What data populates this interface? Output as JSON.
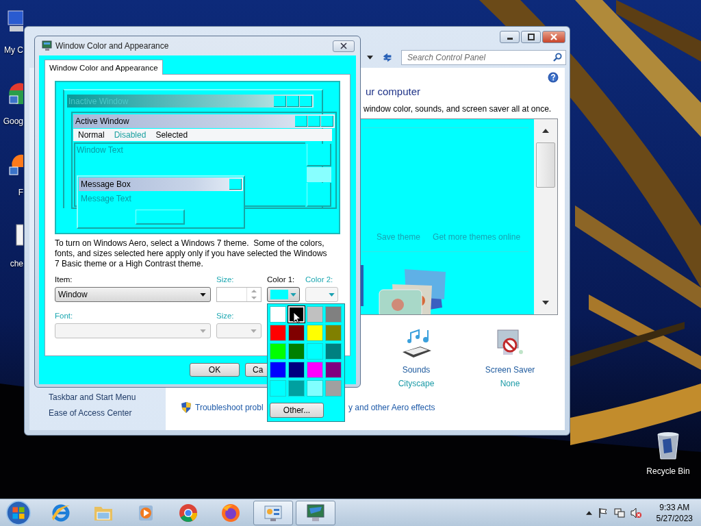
{
  "desktop_icons": [
    {
      "kind": "computer",
      "label": "My C"
    },
    {
      "kind": "chrome",
      "label": "Goog"
    },
    {
      "kind": "firefox",
      "label": "F"
    },
    {
      "kind": "document",
      "label": "che"
    }
  ],
  "recycle_bin": {
    "label": "Recycle Bin"
  },
  "control_panel": {
    "search": {
      "placeholder": "Search Control Panel"
    },
    "heading": "ur computer",
    "intro": "window color, sounds, and screen saver all at once.",
    "theme_links": [
      "Save theme",
      "Get more themes online"
    ],
    "settings": [
      {
        "kind": "sounds",
        "label": "Sounds",
        "value": "Cityscape"
      },
      {
        "kind": "screensaver",
        "label": "Screen Saver",
        "value": "None"
      }
    ],
    "sidebar_links": [
      "Taskbar and Start Menu",
      "Ease of Access Center"
    ],
    "tasks": [
      "Troubleshoot probl",
      "y and other Aero effects"
    ]
  },
  "dialog": {
    "title": "Window Color and Appearance",
    "tabs": [
      {
        "label": "Window Color and Appearance",
        "selected": true
      }
    ],
    "preview": {
      "inactive_title": "Inactive Window",
      "active_title": "Active Window",
      "menu": [
        {
          "kind": "normal",
          "label": "Normal"
        },
        {
          "kind": "disabled",
          "label": "Disabled"
        },
        {
          "kind": "selected",
          "label": "Selected"
        }
      ],
      "window_text": "Window Text",
      "message_title": "Message Box",
      "message_text": "Message Text"
    },
    "note": "To turn on Windows Aero, select a Windows 7 theme.  Some of the colors, fonts, and sizes selected here apply only if you have selected the Windows 7 Basic theme or a High Contrast theme.",
    "fields": [
      {
        "kind": "dropdown",
        "label": "Item:",
        "value": "Window",
        "disabled": false
      },
      {
        "kind": "spinner",
        "label": "Size:",
        "disabled": true
      },
      {
        "kind": "color",
        "label": "Color 1:",
        "color": "#00ffff",
        "disabled": false
      },
      {
        "kind": "color",
        "label": "Color 2:",
        "disabled": true
      },
      {
        "kind": "dropdown",
        "label": "Font:",
        "disabled": true
      },
      {
        "kind": "small_dropdown",
        "label": "Size:",
        "disabled": true
      }
    ],
    "buttons": [
      "OK",
      "Ca"
    ]
  },
  "color_menu": {
    "swatches": [
      {
        "color": "#ffffff",
        "selected": false
      },
      {
        "color": "#000000",
        "selected": true
      },
      {
        "color": "#c0c0c0",
        "selected": false
      },
      {
        "color": "#808080",
        "selected": false
      },
      {
        "color": "#ff0000",
        "selected": false
      },
      {
        "color": "#800000",
        "selected": false
      },
      {
        "color": "#ffff00",
        "selected": false
      },
      {
        "color": "#808000",
        "selected": false
      },
      {
        "color": "#00ff00",
        "selected": false
      },
      {
        "color": "#008000",
        "selected": false
      },
      {
        "color": "#00ffff",
        "selected": false
      },
      {
        "color": "#008080",
        "selected": false
      },
      {
        "color": "#0000ff",
        "selected": false
      },
      {
        "color": "#000080",
        "selected": false
      },
      {
        "color": "#ff00ff",
        "selected": false
      },
      {
        "color": "#800080",
        "selected": false
      },
      {
        "color": "#00ffff",
        "selected": false
      },
      {
        "color": "#00a0a0",
        "selected": false
      },
      {
        "color": "#80ffff",
        "selected": false
      },
      {
        "color": "#a0a0a0",
        "selected": false
      }
    ],
    "other": "Other..."
  },
  "taskbar": {
    "apps": [
      {
        "kind": "ie",
        "active": false
      },
      {
        "kind": "explorer",
        "active": false
      },
      {
        "kind": "media",
        "active": false
      },
      {
        "kind": "chrome",
        "active": false
      },
      {
        "kind": "firefox",
        "active": false
      },
      {
        "kind": "control",
        "active": true
      },
      {
        "kind": "display",
        "active": true
      }
    ],
    "time": "9:33 AM",
    "date": "5/27/2023"
  }
}
